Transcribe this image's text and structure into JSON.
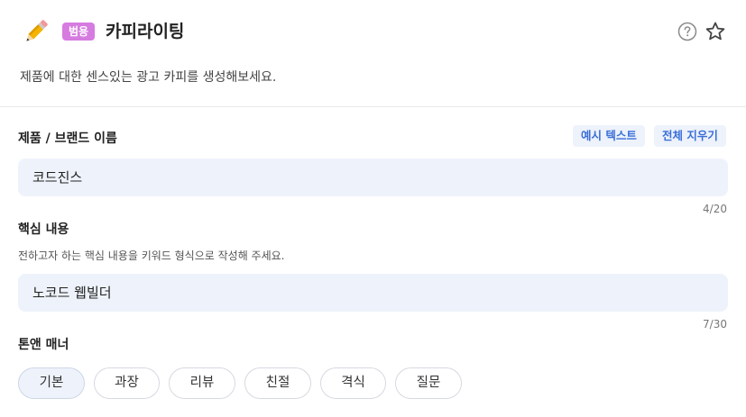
{
  "header": {
    "icon": "pencil-icon",
    "badge": "범용",
    "title": "카피라이팅",
    "help_icon": "question-circle-icon",
    "favorite_icon": "star-outline-icon"
  },
  "description": "제품에 대한 센스있는 광고 카피를 생성해보세요.",
  "form": {
    "product": {
      "label": "제품 / 브랜드 이름",
      "example_button": "예시 텍스트",
      "clear_button": "전체 지우기",
      "value": "코드진스",
      "counter": "4/20"
    },
    "key_content": {
      "label": "핵심 내용",
      "helper": "전하고자 하는 핵심 내용을 키워드 형식으로 작성해 주세요.",
      "value": "노코드 웹빌더",
      "counter": "7/30"
    },
    "tone": {
      "label": "톤앤 매너",
      "options": [
        "기본",
        "과장",
        "리뷰",
        "친절",
        "격식",
        "질문"
      ],
      "selected": "기본"
    }
  },
  "colors": {
    "badge": "#d67be0",
    "accent": "#3a6fd8",
    "input_bg": "#eef3fb"
  }
}
